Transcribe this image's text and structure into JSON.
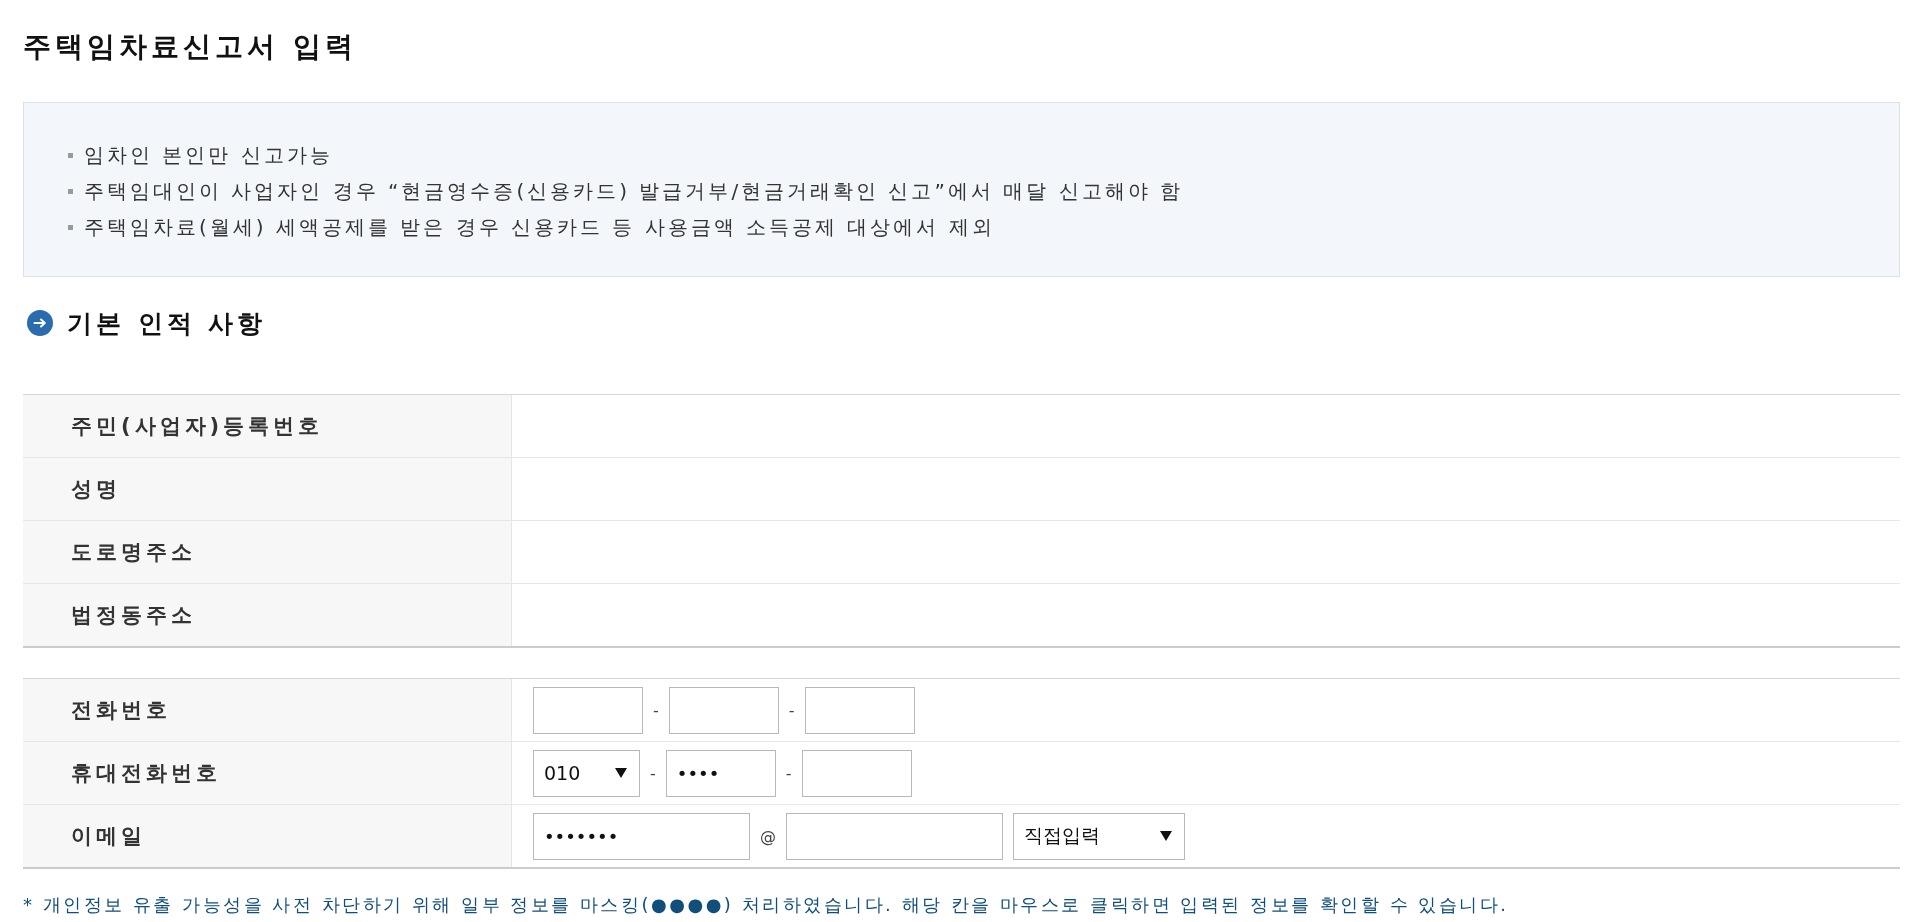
{
  "page": {
    "title": "주택임차료신고서 입력"
  },
  "notice": {
    "items": [
      "임차인 본인만 신고가능",
      "주택임대인이 사업자인 경우 “현금영수증(신용카드) 발급거부/현금거래확인 신고”에서 매달 신고해야 함",
      "주택임차료(월세) 세액공제를 받은 경우 신용카드 등 사용금액 소득공제 대상에서 제외"
    ]
  },
  "section": {
    "title": "기본 인적 사항"
  },
  "identity_table": {
    "rows": [
      {
        "label": "주민(사업자)등록번호"
      },
      {
        "label": "성명"
      },
      {
        "label": "도로명주소"
      },
      {
        "label": "법정동주소"
      }
    ]
  },
  "contact_table": {
    "rows": [
      {
        "label": "전화번호",
        "kind": "phone",
        "fields": [
          {
            "kind": "input"
          },
          {
            "kind": "separator",
            "text": "-"
          },
          {
            "kind": "input"
          },
          {
            "kind": "separator",
            "text": "-"
          },
          {
            "kind": "input"
          }
        ]
      },
      {
        "label": "휴대전화번호",
        "kind": "phone",
        "fields": [
          {
            "kind": "select",
            "value": "010"
          },
          {
            "kind": "separator",
            "text": "-"
          },
          {
            "kind": "input",
            "value": "••••"
          },
          {
            "kind": "separator",
            "text": "-"
          },
          {
            "kind": "input"
          }
        ]
      },
      {
        "label": "이메일",
        "kind": "email",
        "fields": [
          {
            "kind": "input",
            "value": "•••••••"
          },
          {
            "kind": "separator",
            "text": "@"
          },
          {
            "kind": "input"
          },
          {
            "kind": "select",
            "value": "직접입력"
          }
        ]
      }
    ]
  },
  "footnote": "* 개인정보 유출 가능성을 사전 차단하기 위해 일부 정보를 마스킹(●●●●) 처리하였습니다. 해당 칸을 마우스로 클릭하면 입력된 정보를 확인할 수 있습니다."
}
